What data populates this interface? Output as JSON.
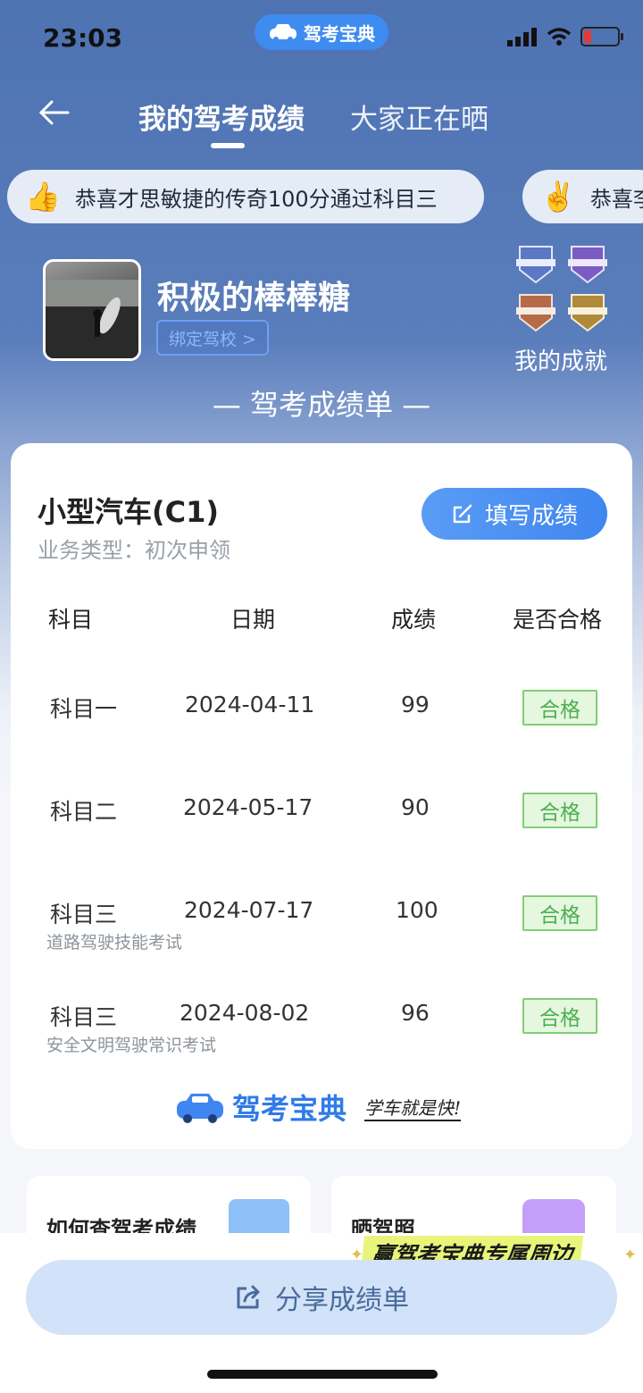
{
  "status": {
    "time": "23:03",
    "app_pill": "驾考宝典"
  },
  "nav": {
    "tab_active": "我的驾考成绩",
    "tab_other": "大家正在晒"
  },
  "ticker": [
    {
      "emoji": "👍",
      "text": "恭喜才思敏捷的传奇100分通过科目三"
    },
    {
      "emoji": "✌️",
      "text": "恭喜李"
    }
  ],
  "profile": {
    "name": "积极的棒棒糖",
    "bind_school": "绑定驾校 >",
    "achievements_label": "我的成就"
  },
  "section_title": "— 驾考成绩单 —",
  "card": {
    "vehicle": "小型汽车(C1)",
    "business_type": "业务类型：初次申领",
    "fill_button": "填写成绩",
    "headers": [
      "科目",
      "日期",
      "成绩",
      "是否合格"
    ],
    "rows": [
      {
        "subject": "科目一",
        "date": "2024-04-11",
        "score": "99",
        "status": "合格",
        "note": ""
      },
      {
        "subject": "科目二",
        "date": "2024-05-17",
        "score": "90",
        "status": "合格",
        "note": ""
      },
      {
        "subject": "科目三",
        "date": "2024-07-17",
        "score": "100",
        "status": "合格",
        "note": "道路驾驶技能考试"
      },
      {
        "subject": "科目三",
        "date": "2024-08-02",
        "score": "96",
        "status": "合格",
        "note": "安全文明驾驶常识考试"
      }
    ],
    "brand": "驾考宝典",
    "slogan": "学车就是快!"
  },
  "mini_cards": [
    {
      "title": "如何查驾考成绩"
    },
    {
      "title": "晒驾照"
    }
  ],
  "promo": "赢驾考宝典专属周边",
  "share_button": "分享成绩单",
  "colors": {
    "primary": "#3f86f0",
    "hero": "#4e73b2",
    "pass_green": "#4caf50"
  }
}
